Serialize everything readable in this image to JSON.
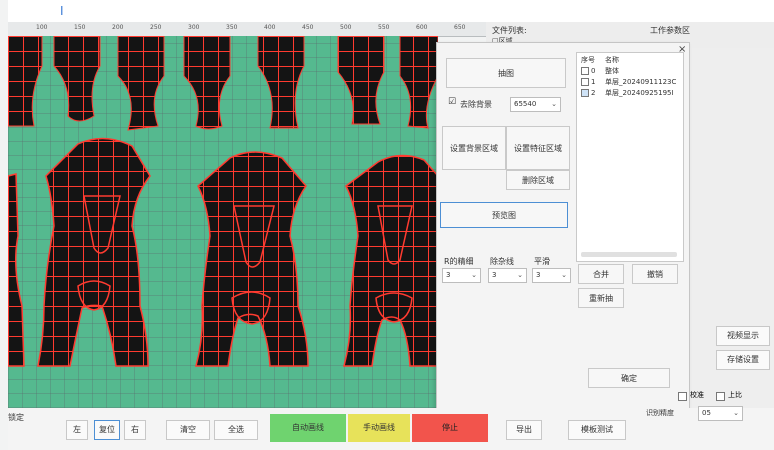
{
  "app": {
    "ruler_ticks": [
      "100",
      "150",
      "200",
      "250",
      "300",
      "350",
      "400",
      "450",
      "500",
      "550",
      "600",
      "650"
    ],
    "file_list_label": "文件列表:",
    "work_params_label": "工作参数区",
    "panel_top_label": "□区域"
  },
  "dialog": {
    "close": "×",
    "extract_button": "抽图",
    "remove_background_checkbox": "☑",
    "remove_background_label": "去除背景",
    "threshold_value": "65540",
    "set_background_region_button": "设置背景区域",
    "set_feature_region_button": "设置特征区域",
    "delete_region_button": "删除区域",
    "preview_button": "预览图",
    "params": [
      {
        "label": "R的精细",
        "value": "3"
      },
      {
        "label": "除杂线",
        "value": "3"
      },
      {
        "label": "平滑",
        "value": "3"
      }
    ],
    "merge_button": "合并",
    "cancel_button": "撤销",
    "refresh_button": "重新抽",
    "confirm_button": "确定",
    "list_headers": {
      "index": "序号",
      "name": "名称"
    },
    "list_rows": [
      {
        "index": "0",
        "name": "整体"
      },
      {
        "index": "1",
        "name": "单层_20240911123C"
      },
      {
        "index": "2",
        "name": "单层_20240925195I"
      }
    ]
  },
  "bottom": {
    "left_label": "锁定",
    "btn_a": "左",
    "btn_b": "复位",
    "btn_c": "右",
    "btn_d": "清空",
    "btn_e": "全选",
    "auto_cut": "自动画线",
    "manual_cut": "手动画线",
    "stop": "停止",
    "export": "导出",
    "mode_test": "模板测试",
    "right_btn_1": "视频显示",
    "right_btn_2": "存储设置",
    "checkbox_a": "校准",
    "checkbox_b": "上比",
    "accuracy_label": "识别精度",
    "accuracy_value": "05"
  },
  "colors": {
    "preview_bg": "#55b98f",
    "shape_fill": "#141414",
    "grid_red": "#ff3b30",
    "auto_green": "#6fd36f",
    "manual_yellow": "#e7e25a",
    "stop_red": "#f2544c"
  }
}
